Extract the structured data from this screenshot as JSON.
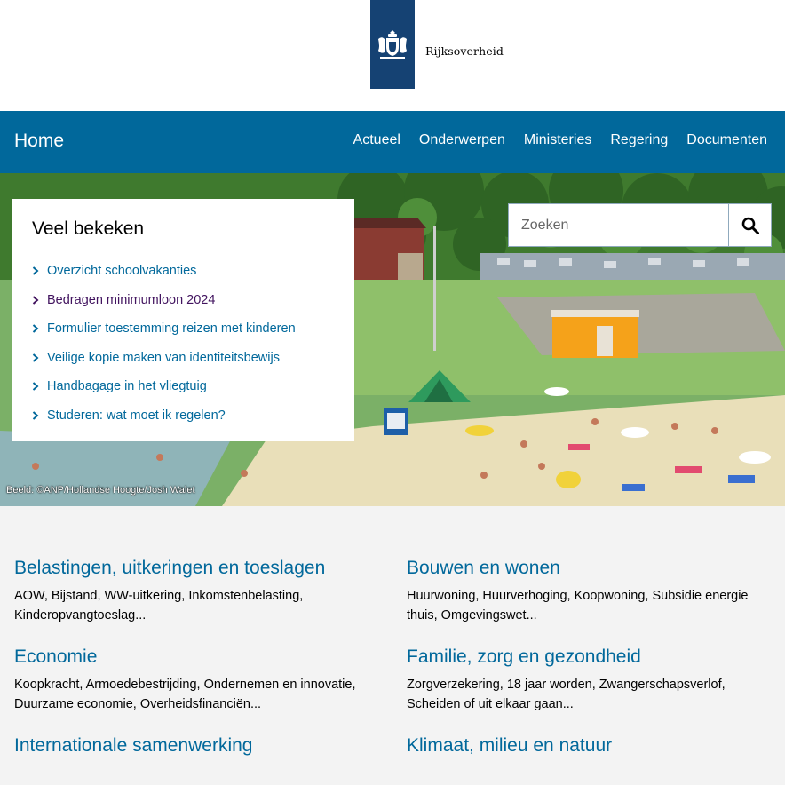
{
  "brand": {
    "name": "Rijksoverheid",
    "color": "#154273"
  },
  "nav": {
    "home": "Home",
    "items": [
      "Actueel",
      "Onderwerpen",
      "Ministeries",
      "Regering",
      "Documenten"
    ],
    "color": "#01689b"
  },
  "search": {
    "placeholder": "Zoeken",
    "icon": "search-icon"
  },
  "popular": {
    "title": "Veel bekeken",
    "items": [
      {
        "label": "Overzicht schoolvakanties",
        "visited": false
      },
      {
        "label": "Bedragen minimumloon 2024",
        "visited": true
      },
      {
        "label": "Formulier toestemming reizen met kinderen",
        "visited": false
      },
      {
        "label": "Veilige kopie maken van identiteitsbewijs",
        "visited": false
      },
      {
        "label": "Handbagage in het vliegtuig",
        "visited": false
      },
      {
        "label": "Studeren: wat moet ik regelen?",
        "visited": false
      }
    ]
  },
  "hero": {
    "credit": "Beeld: ©ANP/Hollandse Hoogte/Josh Walet"
  },
  "topics": [
    {
      "title": "Belastingen, uitkeringen en toeslagen",
      "summary": "AOW, Bijstand, WW-uitkering, Inkomstenbelasting, Kinderopvangtoeslag..."
    },
    {
      "title": "Bouwen en wonen",
      "summary": "Huurwoning, Huurverhoging, Koopwoning, Subsidie energie thuis, Omgevingswet..."
    },
    {
      "title": "Economie",
      "summary": "Koopkracht, Armoedebestrijding, Ondernemen en innovatie, Duurzame economie, Overheidsfinanciën..."
    },
    {
      "title": "Familie, zorg en gezondheid",
      "summary": "Zorgverzekering, 18 jaar worden, Zwangerschapsverlof, Scheiden of uit elkaar gaan..."
    },
    {
      "title": "Internationale samenwerking",
      "summary": ""
    },
    {
      "title": "Klimaat, milieu en natuur",
      "summary": ""
    }
  ]
}
